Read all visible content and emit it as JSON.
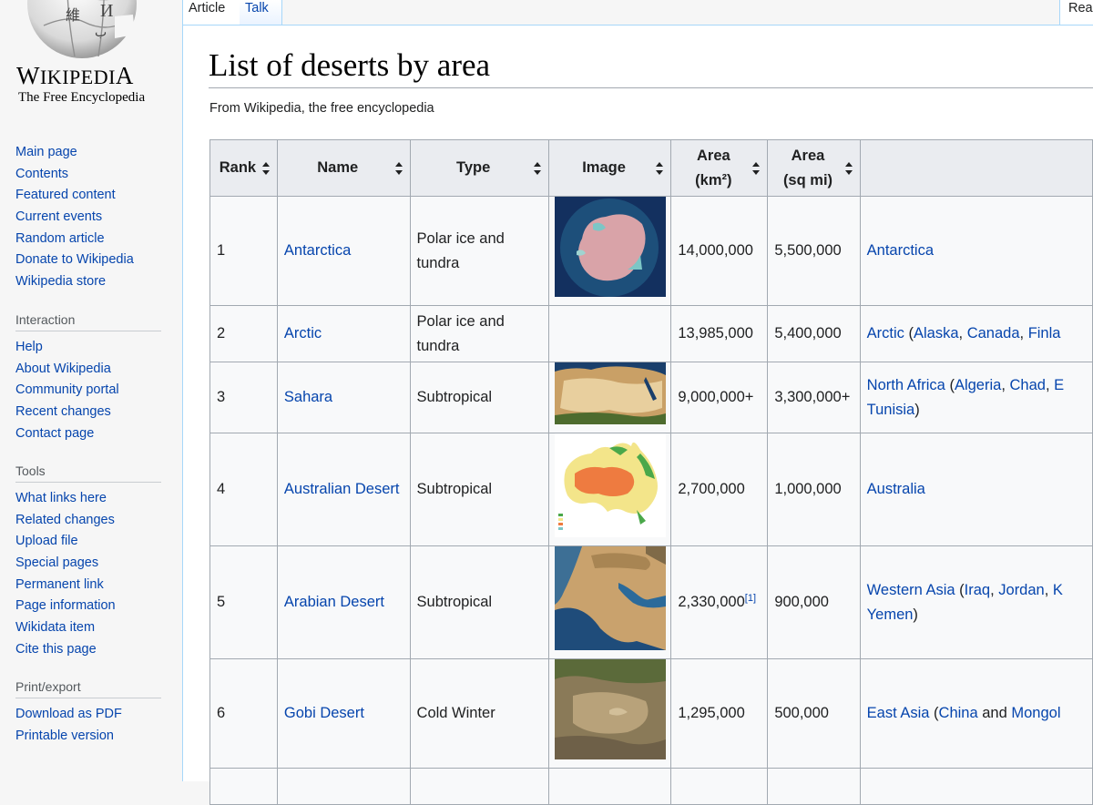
{
  "logo": {
    "wordmark": "Wikipedia",
    "tagline": "The Free Encyclopedia",
    "glyphs": [
      "W",
      "維",
      "И"
    ]
  },
  "navigation": {
    "items": [
      "Main page",
      "Contents",
      "Featured content",
      "Current events",
      "Random article",
      "Donate to Wikipedia",
      "Wikipedia store"
    ]
  },
  "interaction": {
    "heading": "Interaction",
    "items": [
      "Help",
      "About Wikipedia",
      "Community portal",
      "Recent changes",
      "Contact page"
    ]
  },
  "tools": {
    "heading": "Tools",
    "items": [
      "What links here",
      "Related changes",
      "Upload file",
      "Special pages",
      "Permanent link",
      "Page information",
      "Wikidata item",
      "Cite this page"
    ]
  },
  "print": {
    "heading": "Print/export",
    "items": [
      "Download as PDF",
      "Printable version"
    ]
  },
  "tabs": {
    "article": "Article",
    "talk": "Talk",
    "read": "Read"
  },
  "page": {
    "title": "List of deserts by area",
    "subtitle": "From Wikipedia, the free encyclopedia"
  },
  "table": {
    "headers": {
      "rank": "Rank",
      "name": "Name",
      "type": "Type",
      "image": "Image",
      "area_km_1": "Area",
      "area_km_2": "(km²)",
      "area_mi_1": "Area",
      "area_mi_2": "(sq mi)",
      "location": ""
    },
    "rows": [
      {
        "rank": "1",
        "name": "Antarctica",
        "type": "Polar ice and tundra",
        "area_km": "14,000,000",
        "area_mi": "5,500,000",
        "region": "Antarctica",
        "countries": [],
        "has_image": true
      },
      {
        "rank": "2",
        "name": "Arctic",
        "type": "Polar ice and tundra",
        "area_km": "13,985,000",
        "area_mi": "5,400,000",
        "region": "Arctic",
        "countries": [
          "Alaska",
          "Canada",
          "Finla"
        ],
        "has_image": false
      },
      {
        "rank": "3",
        "name": "Sahara",
        "type": "Subtropical",
        "area_km": "9,000,000+",
        "area_mi": "3,300,000+",
        "region": "North Africa",
        "countries": [
          "Algeria",
          "Chad",
          "E"
        ],
        "line2": "Tunisia",
        "has_image": true
      },
      {
        "rank": "4",
        "name": "Australian Desert",
        "type": "Subtropical",
        "area_km": "2,700,000",
        "area_mi": "1,000,000",
        "region": "Australia",
        "countries": [],
        "has_image": true
      },
      {
        "rank": "5",
        "name": "Arabian Desert",
        "type": "Subtropical",
        "area_km": "2,330,000",
        "area_km_ref": "[1]",
        "area_mi": "900,000",
        "region": "Western Asia",
        "countries": [
          "Iraq",
          "Jordan",
          "K"
        ],
        "line2": "Yemen",
        "has_image": true
      },
      {
        "rank": "6",
        "name": "Gobi Desert",
        "type": "Cold Winter",
        "area_km": "1,295,000",
        "area_mi": "500,000",
        "region": "East Asia",
        "countries": [
          "China",
          "Mongol"
        ],
        "has_image": true
      }
    ]
  }
}
